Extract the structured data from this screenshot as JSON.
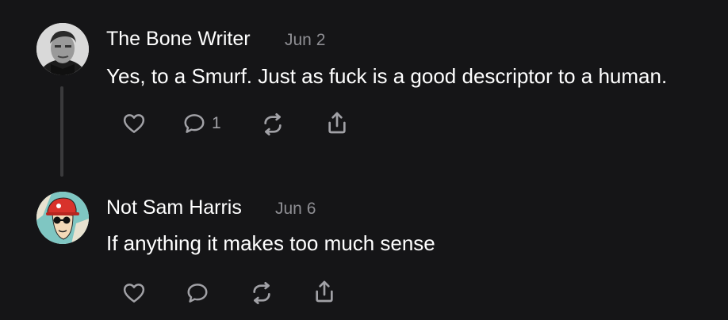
{
  "comments": [
    {
      "author": "The Bone Writer",
      "date": "Jun 2",
      "text": "Yes, to a Smurf. Just as fuck is a good descriptor to a human.",
      "reply_count": "1",
      "avatar": "grayscale-portrait-photo"
    },
    {
      "author": "Not Sam Harris",
      "date": "Jun 6",
      "text": "If anything it makes too much sense",
      "reply_count": "",
      "avatar": "cartoon-man-red-cap-sunglasses"
    }
  ],
  "icons": {
    "like": "heart-icon",
    "reply": "comment-bubble-icon",
    "restack": "restack-icon",
    "share": "share-icon"
  },
  "colors": {
    "background": "#151517",
    "text": "#ffffff",
    "muted": "#8e8e93",
    "icon": "#a1a1a6",
    "thread_line": "#3a3a3c"
  }
}
